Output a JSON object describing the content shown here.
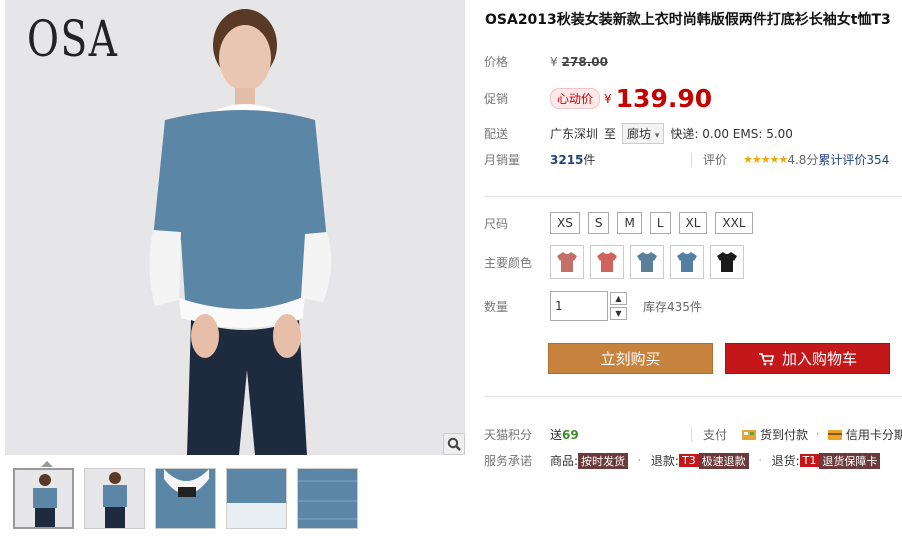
{
  "brand": {
    "logo_text": "OSA"
  },
  "product": {
    "title": "OSA2013秋装女装新款上衣时尚韩版假两件打底衫长袖女t恤T3"
  },
  "price": {
    "label": "价格",
    "currency": "¥",
    "original": "278.00"
  },
  "promo": {
    "label": "促销",
    "tag": "心动价",
    "currency": "¥",
    "price": "139.90"
  },
  "shipping": {
    "label": "配送",
    "from": "广东深圳",
    "to_word": "至",
    "dest": "廊坊",
    "fees": "快递: 0.00 EMS: 5.00"
  },
  "sales": {
    "label": "月销量",
    "count": "3215",
    "unit": "件",
    "review_label": "评价",
    "stars": "★★★★★",
    "score": "4.8分",
    "review_count": "累计评价354"
  },
  "sizes": {
    "label": "尺码",
    "options": [
      "XS",
      "S",
      "M",
      "L",
      "XL",
      "XXL"
    ]
  },
  "colors": {
    "label": "主要颜色",
    "swatches": [
      "rose",
      "coral",
      "steel-blue",
      "denim-blue",
      "black"
    ],
    "swatch_colors": [
      "#c27068",
      "#d0635b",
      "#5a7f98",
      "#537fa4",
      "#1a1a1a"
    ]
  },
  "quantity": {
    "label": "数量",
    "value": "1",
    "stock": "库存435件"
  },
  "actions": {
    "buy": "立刻购买",
    "cart": "加入购物车"
  },
  "points": {
    "label": "天猫积分",
    "prefix": "送",
    "value": "69"
  },
  "payment": {
    "label": "支付",
    "cod": "货到付款",
    "card": "信用卡分期"
  },
  "service": {
    "label": "服务承诺",
    "goods_label": "商品:",
    "goods_badge": "按时发货",
    "refund_label": "退款:",
    "refund_code": "T3",
    "refund_badge": "极速退款",
    "return_label": "退货:",
    "return_code": "T1",
    "return_badge": "退货保障卡"
  }
}
